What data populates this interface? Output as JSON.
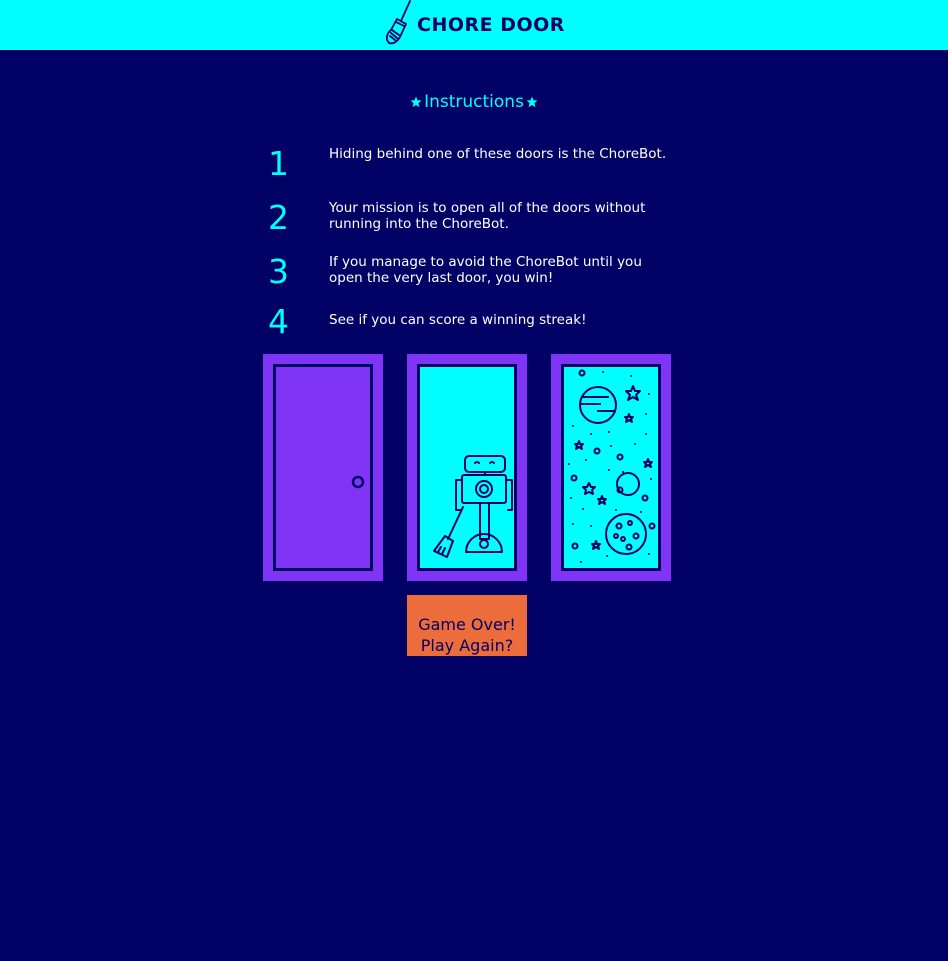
{
  "header": {
    "title": "CHORE DOOR",
    "logo_icon": "broom-icon",
    "background": "#00ffff"
  },
  "instructions": {
    "heading": "Instructions",
    "heading_icon": "star-icon",
    "steps": [
      {
        "number": "1",
        "text": "Hiding behind one of these doors is the ChoreBot."
      },
      {
        "number": "2",
        "text": "Your mission is to open all of the doors without running into the ChoreBot."
      },
      {
        "number": "3",
        "text": "If you manage to avoid the ChoreBot until you open the very last door, you win!"
      },
      {
        "number": "4",
        "text": "See if you can score a winning streak!"
      }
    ]
  },
  "doors": [
    {
      "state": "closed",
      "image": "closed-door"
    },
    {
      "state": "open",
      "image": "chorebot-robot"
    },
    {
      "state": "open",
      "image": "space-scene"
    }
  ],
  "play_button": {
    "line1": "Game Over!",
    "line2": "Play Again?"
  },
  "colors": {
    "background": "#010165",
    "accent": "#00ffff",
    "door_frame": "#8034f5",
    "button": "#ec6c3c",
    "text": "#ffffff"
  }
}
